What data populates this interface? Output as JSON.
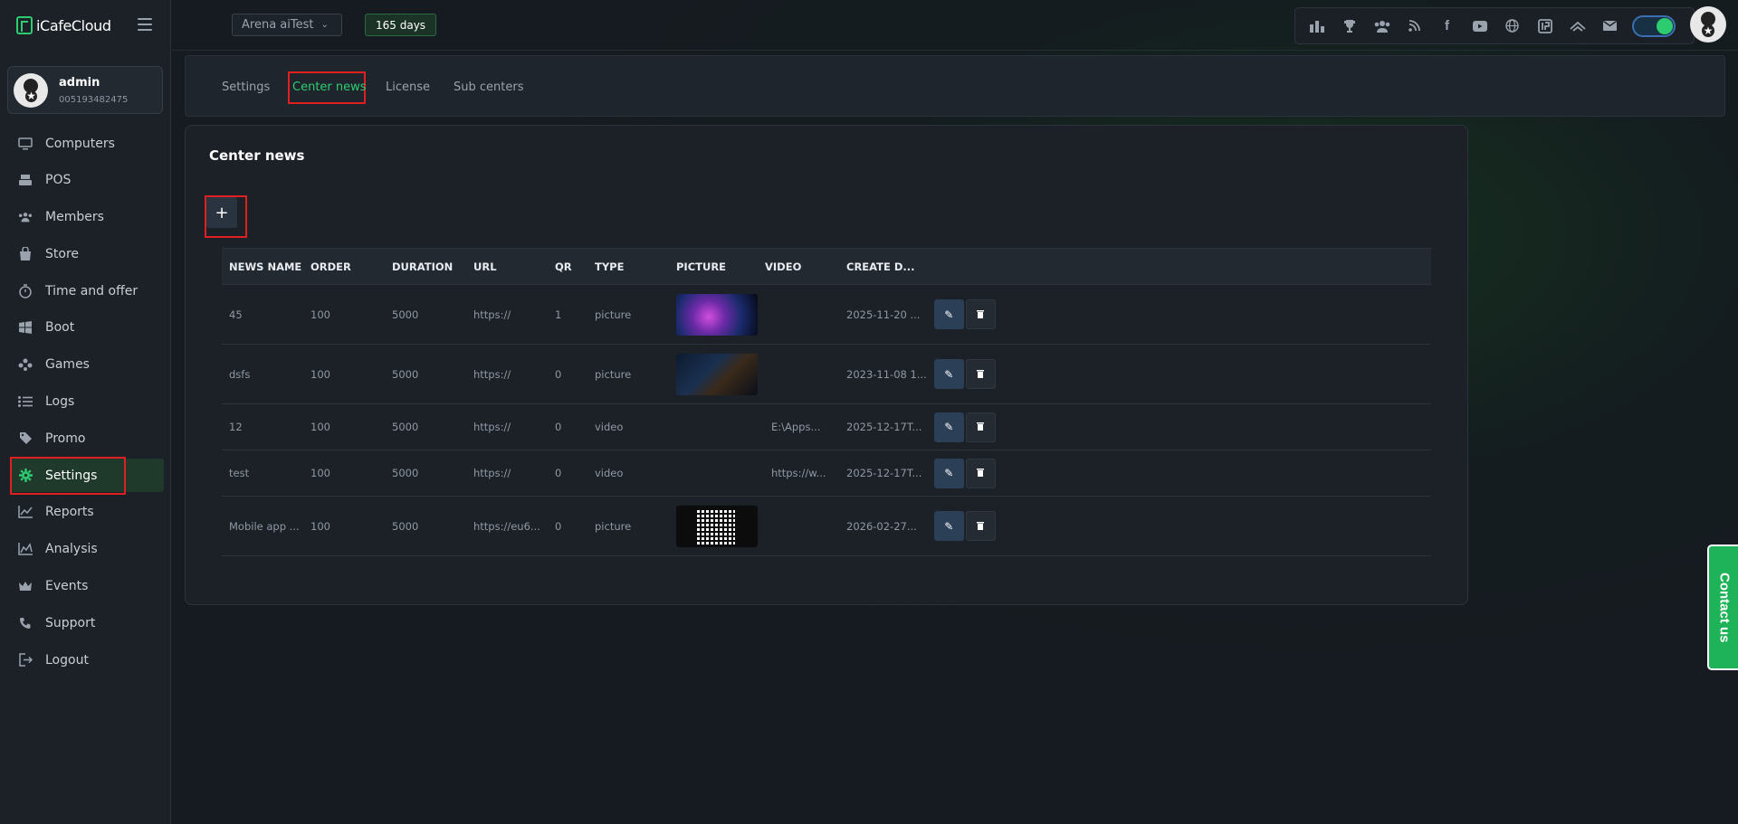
{
  "app": {
    "name": "iCafeCloud"
  },
  "user": {
    "name": "admin",
    "id": "005193482475"
  },
  "topbar": {
    "center": "Arena aiTest",
    "days": "165 days"
  },
  "tray_icons": [
    "leaderboard-icon",
    "trophy-icon",
    "group-icon",
    "rss-icon",
    "facebook-icon",
    "youtube-icon",
    "globe-icon",
    "icafe-icon",
    "double-chevron-icon",
    "mail-icon"
  ],
  "sidebar": {
    "items": [
      {
        "label": "Computers",
        "icon": "monitor-icon"
      },
      {
        "label": "POS",
        "icon": "pos-icon"
      },
      {
        "label": "Members",
        "icon": "members-icon"
      },
      {
        "label": "Store",
        "icon": "store-icon"
      },
      {
        "label": "Time and offer",
        "icon": "timer-icon"
      },
      {
        "label": "Boot",
        "icon": "windows-icon"
      },
      {
        "label": "Games",
        "icon": "gamepad-icon"
      },
      {
        "label": "Logs",
        "icon": "list-icon"
      },
      {
        "label": "Promo",
        "icon": "tag-icon"
      },
      {
        "label": "Settings",
        "icon": "gear-icon"
      },
      {
        "label": "Reports",
        "icon": "line-chart-icon"
      },
      {
        "label": "Analysis",
        "icon": "area-chart-icon"
      },
      {
        "label": "Events",
        "icon": "crown-icon"
      },
      {
        "label": "Support",
        "icon": "phone-icon"
      },
      {
        "label": "Logout",
        "icon": "logout-icon"
      }
    ]
  },
  "tabs": [
    "Settings",
    "Center news",
    "License",
    "Sub centers"
  ],
  "page": {
    "title": "Center news",
    "add_label": "+"
  },
  "table": {
    "headers": [
      "NEWS NAME",
      "ORDER",
      "DURATION",
      "URL",
      "QR",
      "TYPE",
      "PICTURE",
      "VIDEO",
      "CREATE D..."
    ],
    "rows": [
      {
        "name": "45",
        "order": "100",
        "duration": "5000",
        "url": "https://",
        "qr": "1",
        "type": "picture",
        "video": "",
        "created": "2025-11-20 ..."
      },
      {
        "name": "dsfs",
        "order": "100",
        "duration": "5000",
        "url": "https://",
        "qr": "0",
        "type": "picture",
        "video": "",
        "created": "2023-11-08 1..."
      },
      {
        "name": "12",
        "order": "100",
        "duration": "5000",
        "url": "https://",
        "qr": "0",
        "type": "video",
        "video": "E:\\Apps...",
        "created": "2025-12-17T..."
      },
      {
        "name": "test",
        "order": "100",
        "duration": "5000",
        "url": "https://",
        "qr": "0",
        "type": "video",
        "video": "https://w...",
        "created": "2025-12-17T..."
      },
      {
        "name": "Mobile app ...",
        "order": "100",
        "duration": "5000",
        "url": "https://eu6...",
        "qr": "0",
        "type": "picture",
        "video": "",
        "created": "2026-02-27..."
      }
    ]
  },
  "contact": {
    "label": "Contact us"
  }
}
